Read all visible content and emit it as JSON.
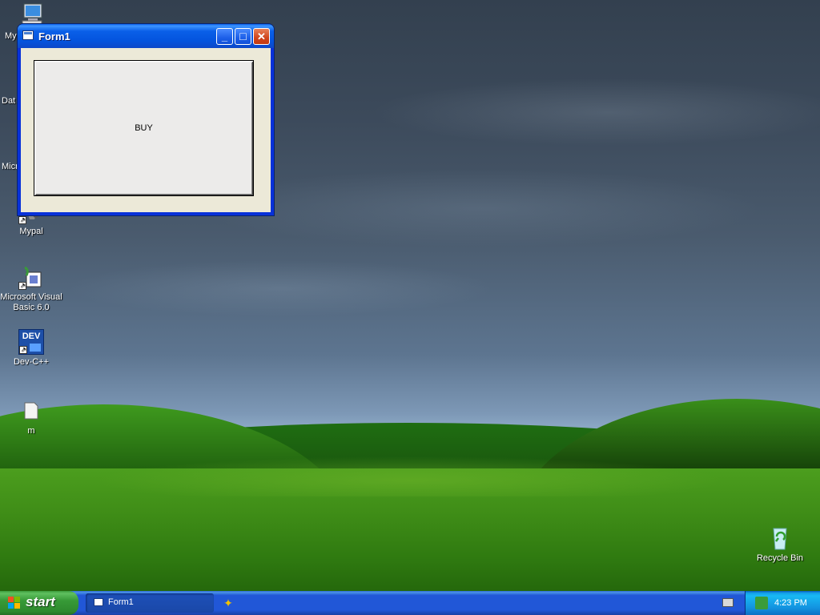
{
  "window": {
    "title": "Form1",
    "minimize_glyph": "_",
    "maximize_glyph": "□",
    "close_glyph": "✕",
    "button_label": "BUY"
  },
  "desktop_icons": [
    {
      "label": "My",
      "icon": "my-computer-icon"
    },
    {
      "label": "Dat",
      "icon": "data-icon"
    },
    {
      "label": "Micro",
      "icon": "microsoft-icon"
    },
    {
      "label": "Mypal",
      "icon": "mypal-icon"
    },
    {
      "label": "Microsoft Visual Basic 6.0",
      "icon": "visual-basic-icon"
    },
    {
      "label": "Dev-C++",
      "icon": "dev-cpp-icon",
      "badge": "DEV"
    },
    {
      "label": "m",
      "icon": "folder-icon"
    },
    {
      "label": "Recycle Bin",
      "icon": "recycle-bin-icon"
    }
  ],
  "taskbar": {
    "start_label": "start",
    "task_item": "Form1",
    "clock": "4:23 PM"
  },
  "colors": {
    "taskbar_blue": "#2157d7",
    "start_green": "#379a37",
    "title_blue": "#0454de",
    "close_red": "#d0451c"
  }
}
